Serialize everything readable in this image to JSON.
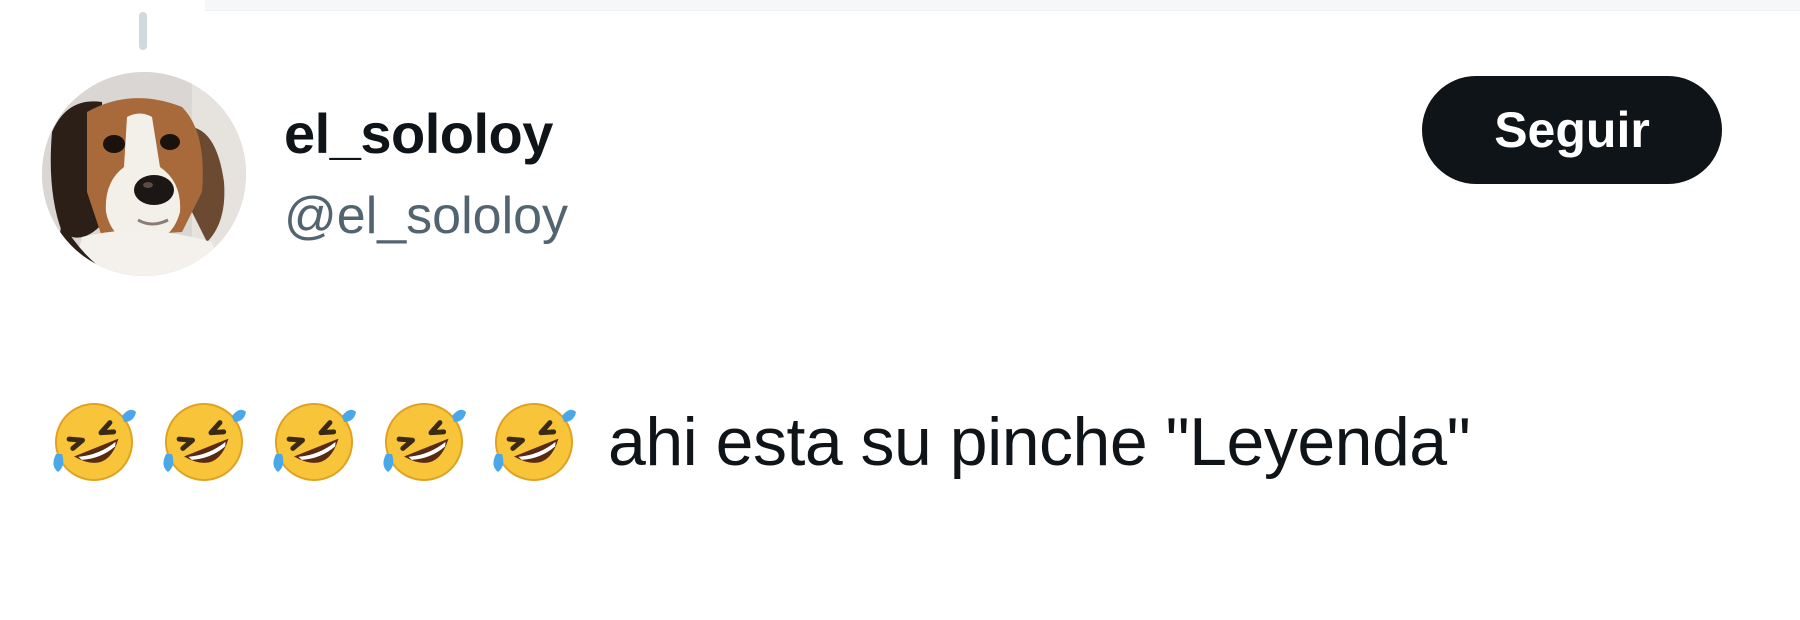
{
  "tweet": {
    "author": {
      "display_name": "el_sololoy",
      "handle": "@el_sololoy",
      "avatar_icon": "beagle-dog-avatar"
    },
    "follow_button_label": "Seguir",
    "emojis": [
      "rolling-on-floor-laughing",
      "rolling-on-floor-laughing",
      "rolling-on-floor-laughing",
      "rolling-on-floor-laughing",
      "rolling-on-floor-laughing"
    ],
    "text": "ahi esta su pinche \"Leyenda\""
  },
  "colors": {
    "text_primary": "#0f1419",
    "text_secondary": "#536471",
    "button_bg": "#0f1419",
    "button_text": "#ffffff",
    "thread_line": "#cfd9de"
  }
}
